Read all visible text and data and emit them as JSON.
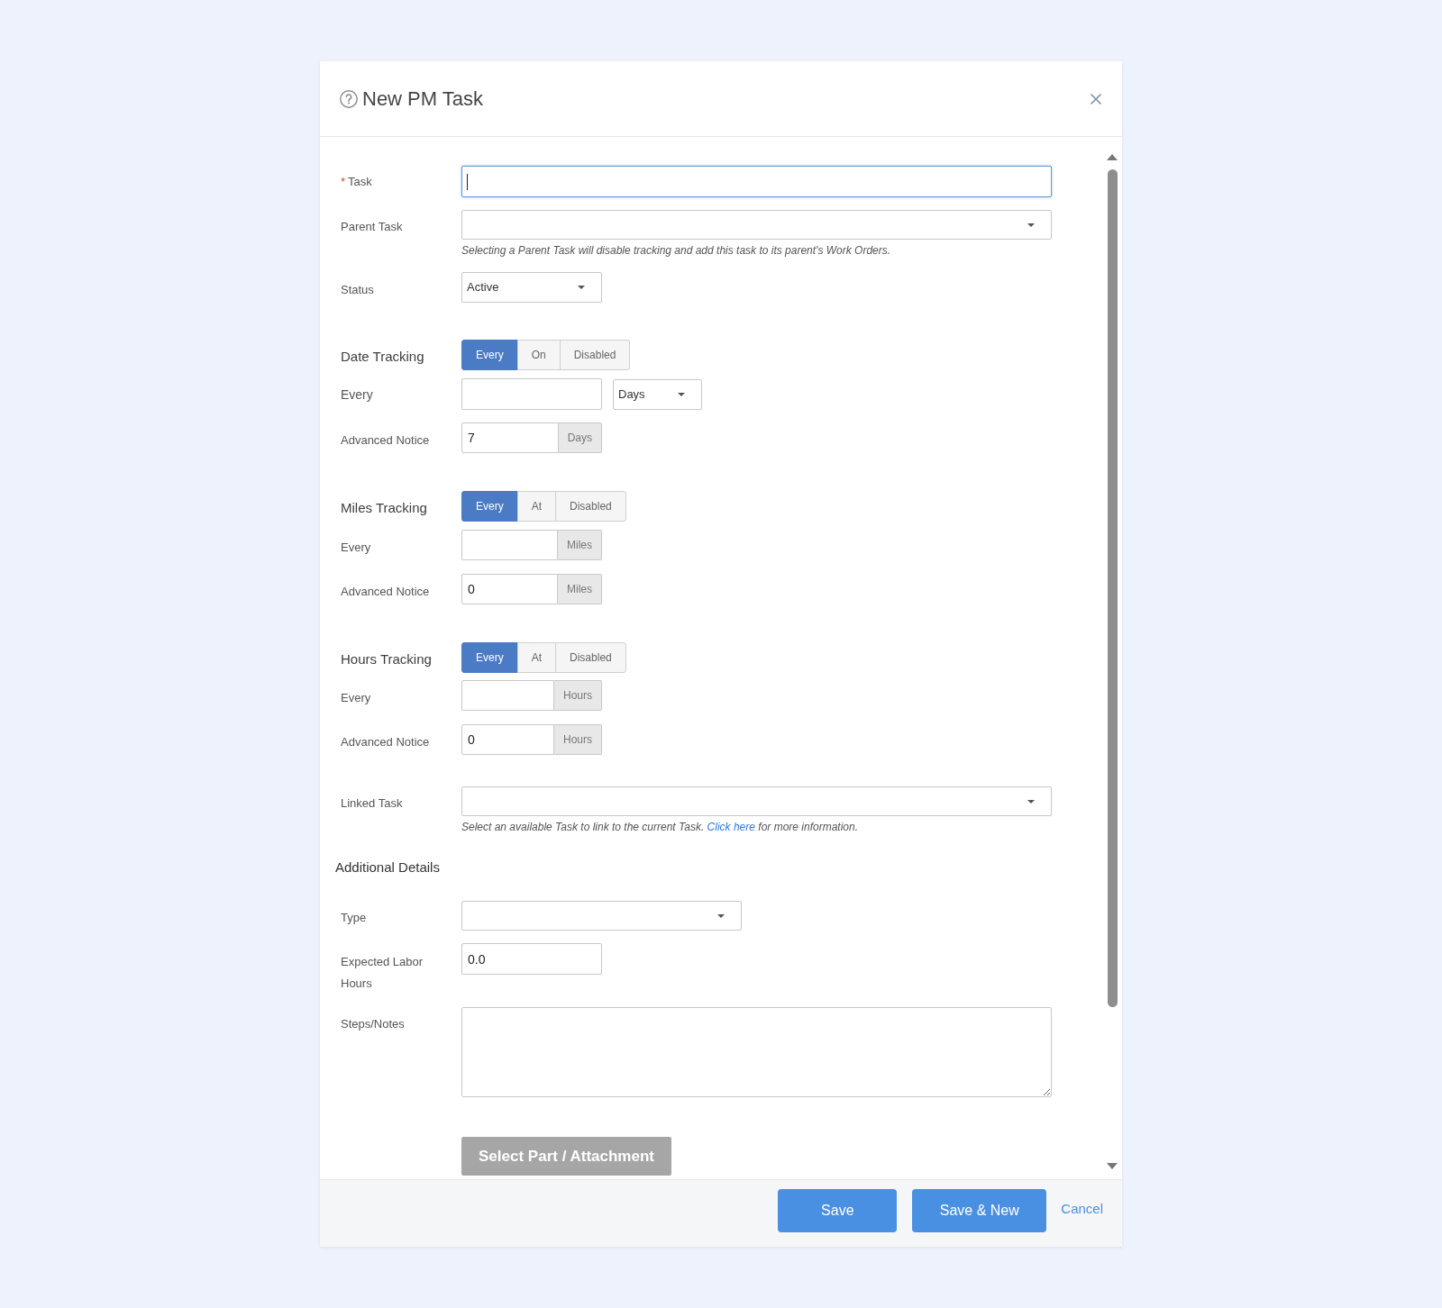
{
  "dialog": {
    "title": "New PM Task"
  },
  "task": {
    "label": "Task",
    "required_mark": "*",
    "focused": true
  },
  "parent_task": {
    "label": "Parent Task",
    "help": "Selecting a Parent Task will disable tracking and add this task to its parent's Work Orders."
  },
  "status": {
    "label": "Status",
    "value": "Active"
  },
  "tracking": [
    {
      "label": "Date Tracking",
      "modes": [
        {
          "label": "Every",
          "selected": true
        },
        {
          "label": "On",
          "selected": false
        },
        {
          "label": "Disabled",
          "selected": false
        }
      ],
      "rows": [
        {
          "kind": "select_unit",
          "label": "Every",
          "unit": "Days"
        },
        {
          "kind": "addon",
          "label": "Advanced Notice",
          "value": "7",
          "unit": "Days"
        }
      ]
    },
    {
      "label": "Miles Tracking",
      "modes": [
        {
          "label": "Every",
          "selected": true
        },
        {
          "label": "At",
          "selected": false
        },
        {
          "label": "Disabled",
          "selected": false
        }
      ],
      "rows": [
        {
          "kind": "addon",
          "label": "Every",
          "unit": "Miles"
        },
        {
          "kind": "addon",
          "label": "Advanced Notice",
          "value": "0",
          "unit": "Miles"
        }
      ]
    },
    {
      "label": "Hours Tracking",
      "modes": [
        {
          "label": "Every",
          "selected": true
        },
        {
          "label": "At",
          "selected": false
        },
        {
          "label": "Disabled",
          "selected": false
        }
      ],
      "rows": [
        {
          "kind": "addon",
          "label": "Every",
          "unit": "Hours"
        },
        {
          "kind": "addon",
          "label": "Advanced Notice",
          "value": "0",
          "unit": "Hours"
        }
      ]
    }
  ],
  "linked_task": {
    "label": "Linked Task",
    "help": {
      "before": "Select an available Task to link to the current Task.",
      "link": "Click here",
      "after": "for more information."
    }
  },
  "additional": {
    "heading": "Additional Details",
    "type": {
      "label": "Type"
    },
    "labor": {
      "label": "Expected Labor Hours",
      "value": "0.0"
    },
    "notes": {
      "label": "Steps/Notes"
    },
    "attachment_button": {
      "label": "Select Part / Attachment",
      "disabled": true
    }
  },
  "footer": {
    "buttons": [
      {
        "label": "Save",
        "kind": "primary"
      },
      {
        "label": "Save & New",
        "kind": "primary"
      },
      {
        "label": "Cancel",
        "kind": "link"
      }
    ]
  }
}
